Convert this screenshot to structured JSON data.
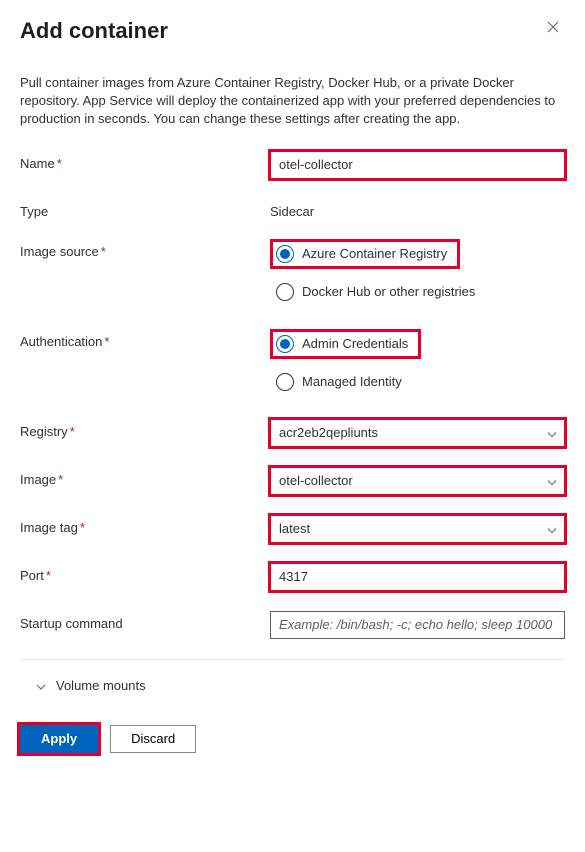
{
  "header": {
    "title": "Add container"
  },
  "description": "Pull container images from Azure Container Registry, Docker Hub, or a private Docker repository. App Service will deploy the containerized app with your preferred dependencies to production in seconds. You can change these settings after creating the app.",
  "fields": {
    "name": {
      "label": "Name",
      "value": "otel-collector"
    },
    "type": {
      "label": "Type",
      "value": "Sidecar"
    },
    "imageSource": {
      "label": "Image source",
      "options": [
        "Azure Container Registry",
        "Docker Hub or other registries"
      ],
      "selected": "Azure Container Registry"
    },
    "authentication": {
      "label": "Authentication",
      "options": [
        "Admin Credentials",
        "Managed Identity"
      ],
      "selected": "Admin Credentials"
    },
    "registry": {
      "label": "Registry",
      "value": "acr2eb2qepliunts"
    },
    "image": {
      "label": "Image",
      "value": "otel-collector"
    },
    "imageTag": {
      "label": "Image tag",
      "value": "latest"
    },
    "port": {
      "label": "Port",
      "value": "4317"
    },
    "startup": {
      "label": "Startup command",
      "placeholder": "Example: /bin/bash; -c; echo hello; sleep 10000"
    }
  },
  "expander": {
    "label": "Volume mounts"
  },
  "actions": {
    "apply": "Apply",
    "discard": "Discard"
  }
}
